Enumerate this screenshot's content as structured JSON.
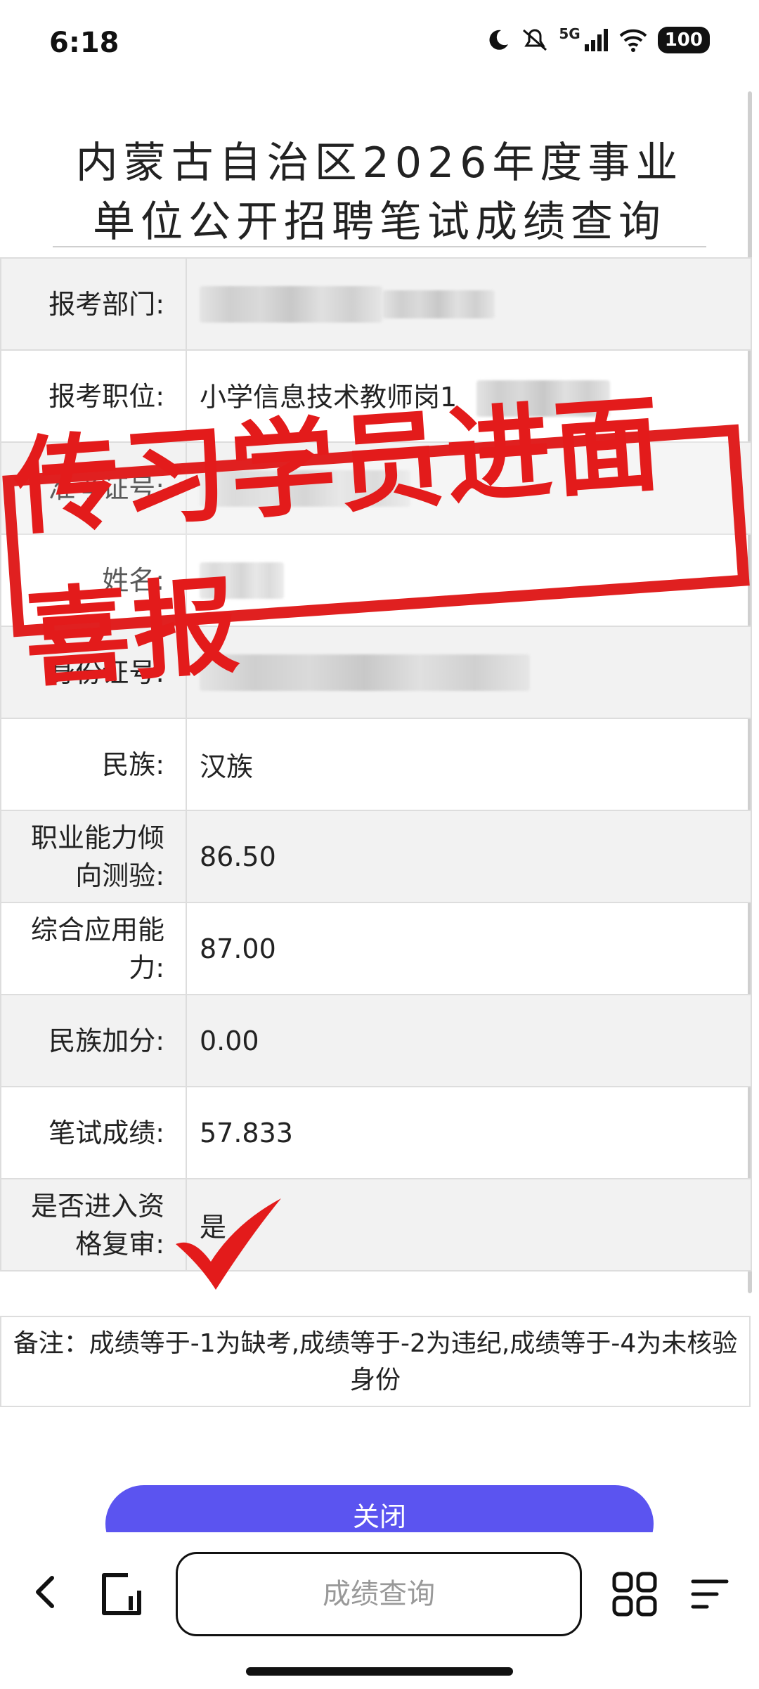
{
  "status_bar": {
    "time": "6:18",
    "network": "5G",
    "battery": "100"
  },
  "page": {
    "title_line1": "内蒙古自治区2026年度事业",
    "title_line2": "单位公开招聘笔试成绩查询"
  },
  "rows": [
    {
      "label": "报考部门:",
      "value": ""
    },
    {
      "label": "报考职位:",
      "value": "小学信息技术教师岗1"
    },
    {
      "label": "准考证号:",
      "value": ""
    },
    {
      "label": "姓名:",
      "value": ""
    },
    {
      "label": "身份证号:",
      "value": ""
    },
    {
      "label": "民族:",
      "value": "汉族"
    },
    {
      "label": "职业能力倾向测验:",
      "value": "86.50"
    },
    {
      "label": "综合应用能力:",
      "value": "87.00"
    },
    {
      "label": "民族加分:",
      "value": "0.00"
    },
    {
      "label": "笔试成绩:",
      "value": "57.833"
    },
    {
      "label": "是否进入资格复审:",
      "value": "是"
    }
  ],
  "note": "备注：成绩等于-1为缺考,成绩等于-2为违纪,成绩等于-4为未核验身份",
  "close_button": "关闭",
  "stamp": "传习学员进面喜报",
  "browser": {
    "address_text": "成绩查询"
  },
  "colors": {
    "accent": "#5b54f0",
    "stamp_red": "#e02020"
  }
}
